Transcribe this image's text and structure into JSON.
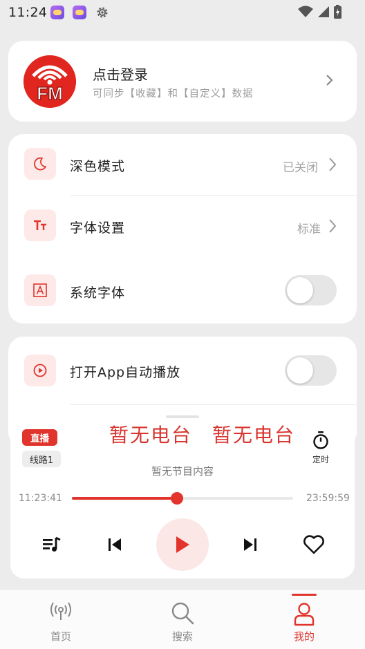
{
  "status_bar": {
    "time": "11:24",
    "icons": [
      "weather-app-icon",
      "weather-app-icon",
      "gear-icon",
      "wifi-icon",
      "signal-icon",
      "battery-charging-icon"
    ]
  },
  "login": {
    "logo_text": "FM",
    "title": "点击登录",
    "subtitle": "可同步【收藏】和【自定义】数据"
  },
  "settings": {
    "dark_mode": {
      "label": "深色模式",
      "value": "已关闭"
    },
    "font_settings": {
      "label": "字体设置",
      "value": "标准"
    },
    "system_font": {
      "label": "系统字体",
      "enabled": false
    },
    "autoplay": {
      "label": "打开App自动播放",
      "enabled": false
    }
  },
  "player": {
    "live_badge": "直播",
    "line_badge": "线路1",
    "station_name": "暂无电台",
    "program": "暂无节目内容",
    "timer_label": "定时",
    "time_current": "11:23:41",
    "time_end": "23:59:59",
    "progress": 0.475,
    "accent": "#e2342c"
  },
  "tabs": [
    {
      "label": "首页",
      "icon": "radio-signal-icon"
    },
    {
      "label": "搜索",
      "icon": "search-icon"
    },
    {
      "label": "我的",
      "icon": "user-icon",
      "active": true
    }
  ]
}
